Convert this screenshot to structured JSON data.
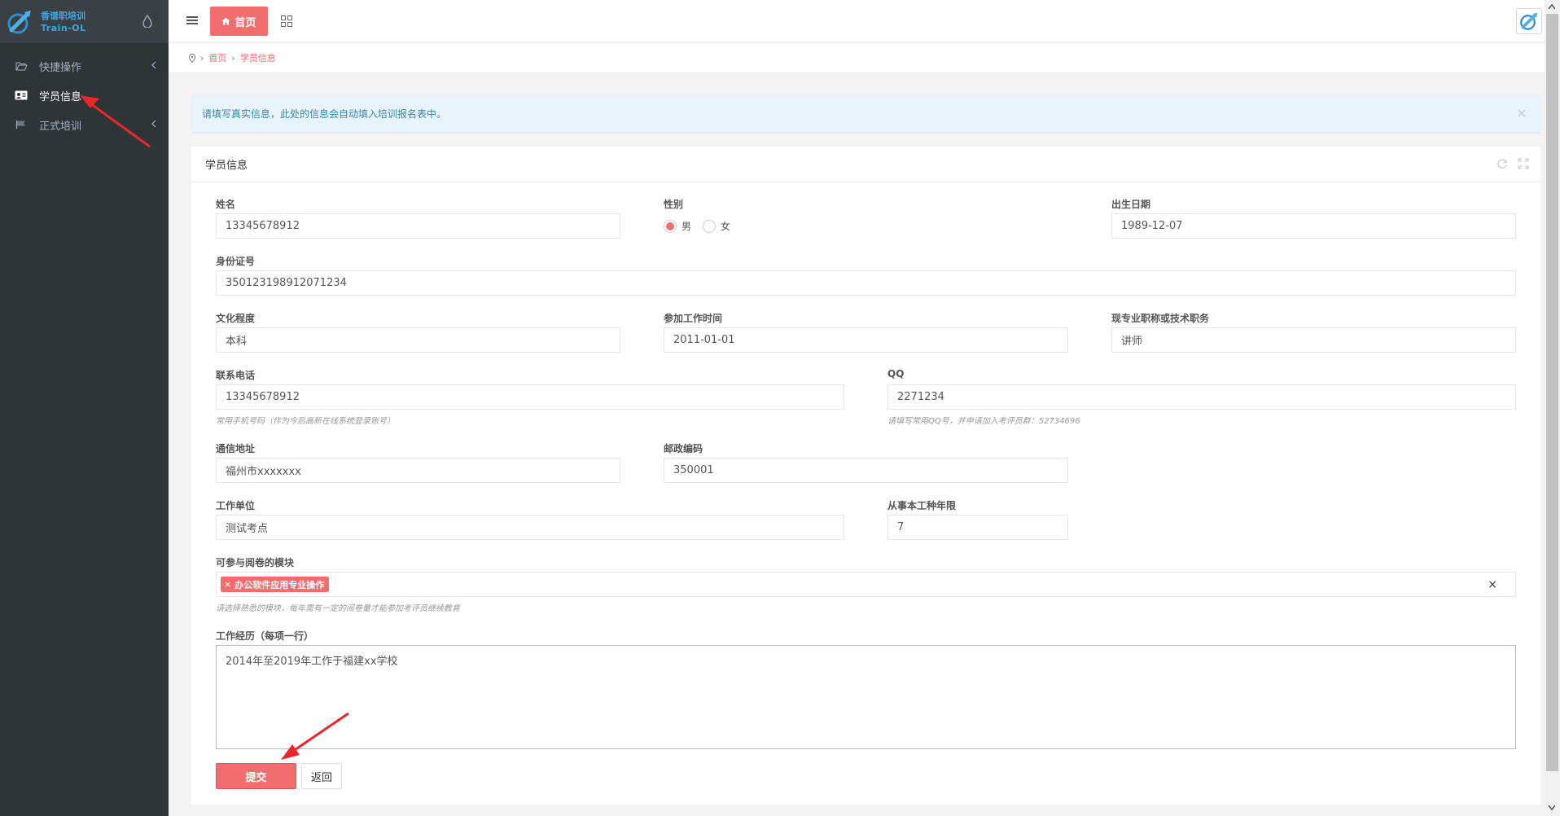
{
  "app": {
    "logo_line1": "香谱职培训",
    "logo_line2": "Train-OL"
  },
  "sidebar": {
    "items": [
      {
        "label": "快捷操作",
        "icon": "folder-open-icon",
        "has_caret": true,
        "active": false
      },
      {
        "label": "学员信息",
        "icon": "id-card-icon",
        "has_caret": false,
        "active": true
      },
      {
        "label": "正式培训",
        "icon": "flag-icon",
        "has_caret": true,
        "active": false
      }
    ]
  },
  "topbar": {
    "home_tab_label": "首页"
  },
  "breadcrumb": {
    "items": [
      "首页",
      "学员信息"
    ]
  },
  "alert": {
    "text": "请填写真实信息，此处的信息会自动填入培训报名表中。"
  },
  "panel": {
    "title": "学员信息"
  },
  "form": {
    "name": {
      "label": "姓名",
      "value": "13345678912"
    },
    "gender": {
      "label": "性别",
      "options": [
        "男",
        "女"
      ],
      "selected": "男"
    },
    "birth": {
      "label": "出生日期",
      "value": "1989-12-07"
    },
    "id_number": {
      "label": "身份证号",
      "value": "350123198912071234"
    },
    "education": {
      "label": "文化程度",
      "value": "本科"
    },
    "work_start": {
      "label": "参加工作时间",
      "value": "2011-01-01"
    },
    "title": {
      "label": "现专业职称或技术职务",
      "value": "讲师"
    },
    "phone": {
      "label": "联系电话",
      "value": "13345678912",
      "hint": "常用手机号码（作为今后高新在线系统登录账号）"
    },
    "qq": {
      "label": "QQ",
      "value": "2271234",
      "hint": "请填写常用QQ号，并申请加入考评员群：52734696"
    },
    "address": {
      "label": "通信地址",
      "value": "福州市xxxxxxx"
    },
    "postcode": {
      "label": "邮政编码",
      "value": "350001"
    },
    "employer": {
      "label": "工作单位",
      "value": "测试考点"
    },
    "years": {
      "label": "从事本工种年限",
      "value": "7"
    },
    "modules": {
      "label": "可参与阅卷的模块",
      "tags": [
        "办公软件应用专业操作"
      ],
      "clear": "×",
      "tag_remove": "×",
      "hint": "请选择熟悉的模块，每年需有一定的阅卷量才能参加考评员继续教育"
    },
    "experience": {
      "label": "工作经历（每项一行）",
      "value": "2014年至2019年工作于福建xx学校"
    }
  },
  "actions": {
    "submit_label": "提交",
    "back_label": "返回"
  },
  "colors": {
    "accent": "#f26d6d",
    "sidebar_bg": "#2f3437",
    "alert_bg": "#e8f3fb",
    "alert_text": "#3a87ad"
  }
}
